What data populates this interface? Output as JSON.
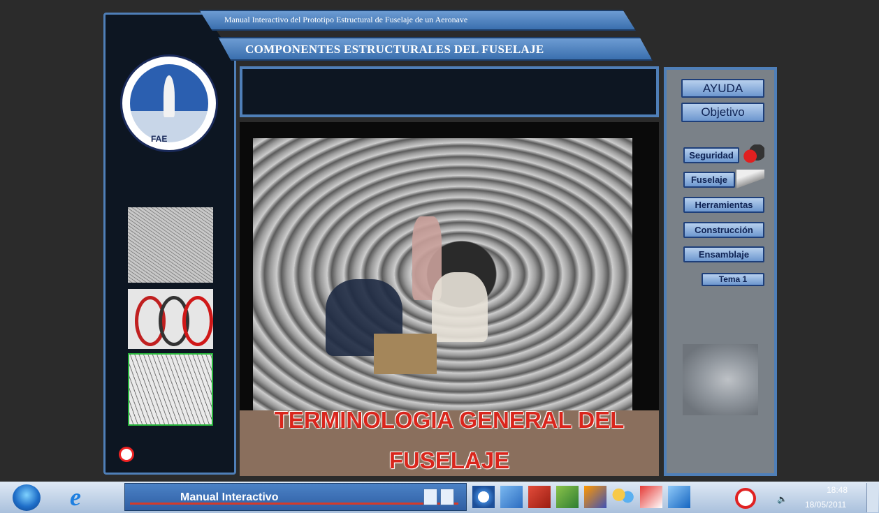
{
  "app": {
    "header_title": "Manual Interactivo del Prototipo Estructural de Fuselaje de un Aeronave",
    "section_title": "COMPONENTES ESTRUCTURALES DEL FUSELAJE"
  },
  "logo": {
    "text": "FAE"
  },
  "main": {
    "caption_line1": "TERMINOLOGIA GENERAL DEL",
    "caption_line2": "FUSELAJE"
  },
  "sidebar_right": {
    "buttons": [
      {
        "label": "AYUDA"
      },
      {
        "label": "Objetivo"
      },
      {
        "label": "Seguridad"
      },
      {
        "label": "Fuselaje"
      },
      {
        "label": "Herramientas"
      },
      {
        "label": "Construcción"
      },
      {
        "label": "Ensamblaje"
      },
      {
        "label": "Tema 1"
      }
    ]
  },
  "taskbar": {
    "app_label": "Manual Interactivo",
    "time": "18:48",
    "date": "18/05/2011"
  },
  "icons": {
    "start": "windows-start-icon",
    "browser": "internet-explorer-icon",
    "no": "no-entry-icon",
    "speaker": "speaker-icon"
  },
  "colors": {
    "accent_blue": "#4f7fb8",
    "caption_red": "#d9261c",
    "panel_dark": "#0d1622"
  }
}
